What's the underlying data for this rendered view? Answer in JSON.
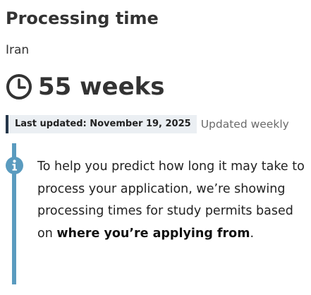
{
  "header": {
    "title": "Processing time",
    "country": "Iran"
  },
  "processing": {
    "icon": "clock-icon",
    "value": "55 weeks"
  },
  "update": {
    "last_updated": "Last updated: November 19, 2025",
    "frequency": "Updated weekly"
  },
  "notice": {
    "icon": "info-icon",
    "text_before": "To help you predict how long it may take to process your application, we’re showing processing times for study permits based on ",
    "text_bold": "where you’re applying from",
    "text_after": "."
  },
  "colors": {
    "accent": "#26374a",
    "info": "#5a9bbf"
  }
}
